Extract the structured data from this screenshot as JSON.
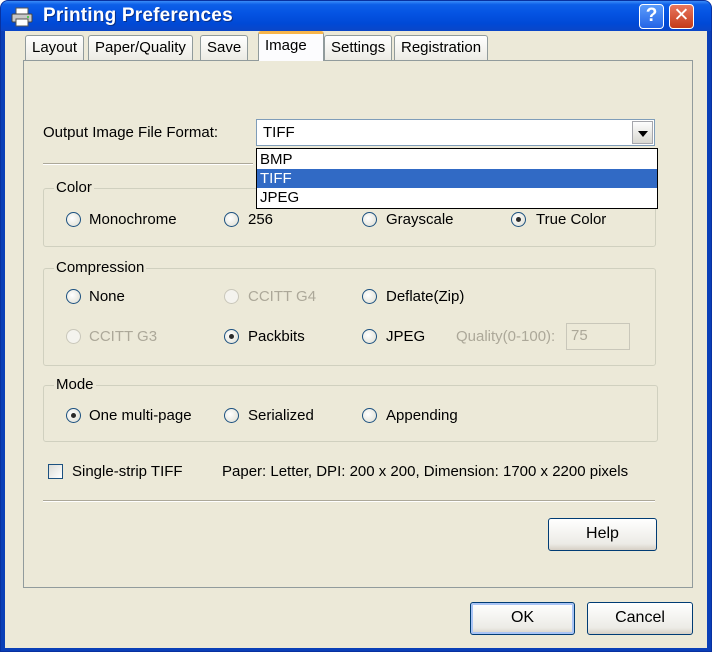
{
  "window": {
    "title": "Printing Preferences",
    "help_glyph": "?",
    "close_glyph": "✕"
  },
  "tabs": [
    {
      "label": "Layout"
    },
    {
      "label": "Paper/Quality"
    },
    {
      "label": "Save"
    },
    {
      "label": "Image",
      "active": true
    },
    {
      "label": "Settings"
    },
    {
      "label": "Registration"
    }
  ],
  "output_format": {
    "label": "Output Image File Format:",
    "value": "TIFF",
    "options": [
      "BMP",
      "TIFF",
      "JPEG"
    ],
    "highlighted": "TIFF"
  },
  "color_group": {
    "title": "Color",
    "options": [
      "Monochrome",
      "256",
      "Grayscale",
      "True Color"
    ],
    "selected": "True Color"
  },
  "compression_group": {
    "title": "Compression",
    "options": [
      "None",
      "CCITT G4",
      "Deflate(Zip)",
      "CCITT G3",
      "Packbits",
      "JPEG"
    ],
    "disabled": [
      "CCITT G4",
      "CCITT G3"
    ],
    "selected": "Packbits",
    "quality_label": "Quality(0-100):",
    "quality_value": "75"
  },
  "mode_group": {
    "title": "Mode",
    "options": [
      "One multi-page",
      "Serialized",
      "Appending"
    ],
    "selected": "One multi-page"
  },
  "single_strip": {
    "label": "Single-strip TIFF",
    "checked": false
  },
  "info_text": "Paper: Letter, DPI: 200 x 200, Dimension: 1700 x 2200 pixels",
  "buttons": {
    "help": "Help",
    "ok": "OK",
    "cancel": "Cancel"
  },
  "colors": {
    "titlebar": "#0554e3",
    "dialog_bg": "#ece9d8",
    "selection": "#316ac5",
    "active_tab_accent": "#f7b54b"
  }
}
